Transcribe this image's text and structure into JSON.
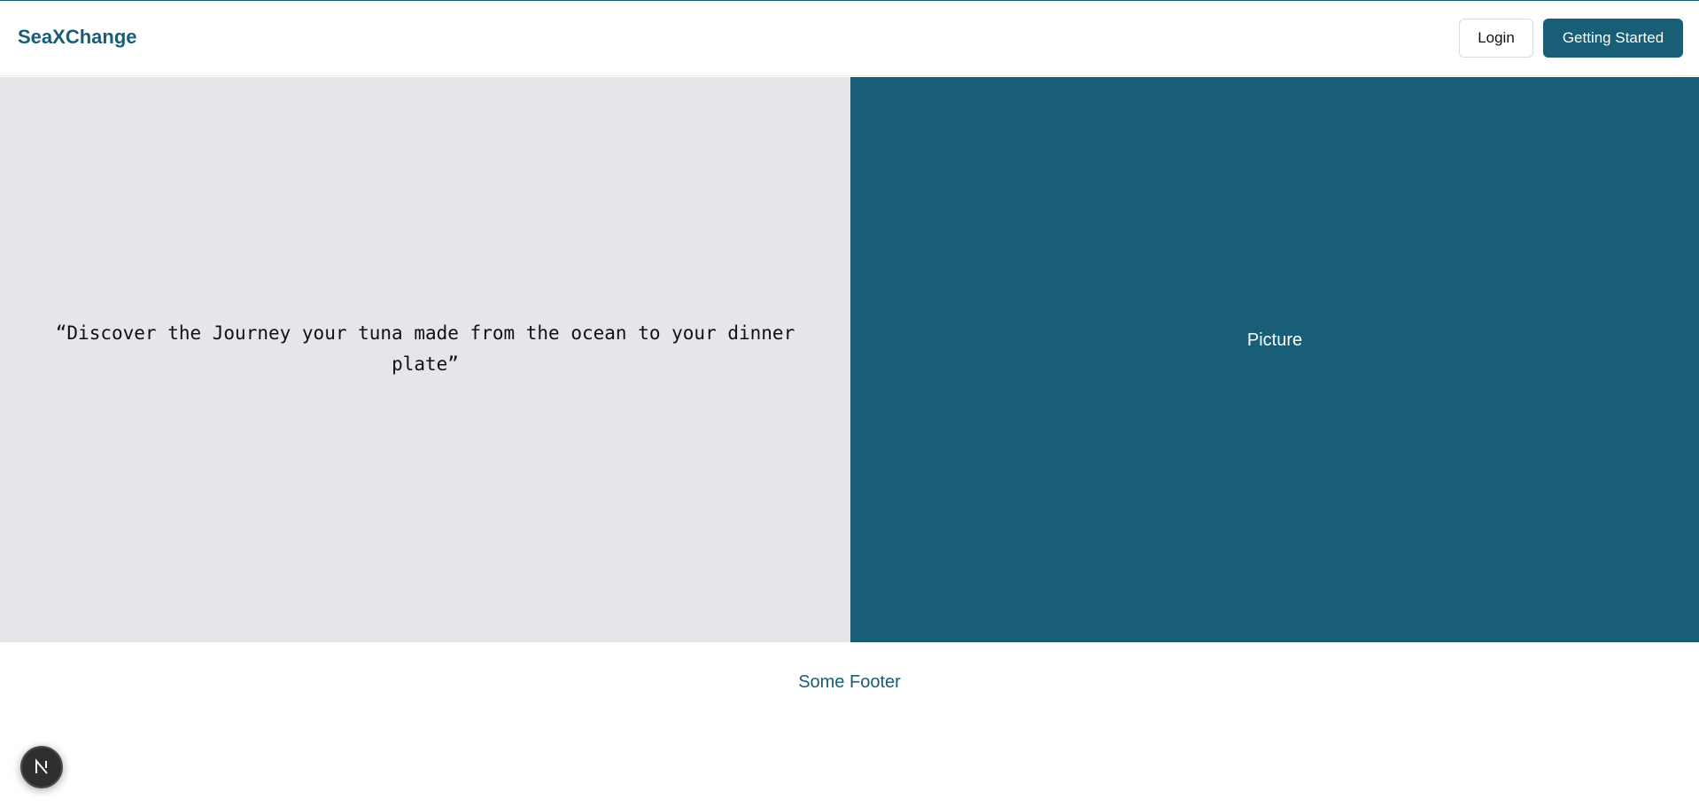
{
  "header": {
    "brand": "SeaXChange",
    "login_label": "Login",
    "start_label": "Getting Started"
  },
  "hero": {
    "quote": "“Discover the Journey your tuna made from the ocean to your dinner plate”",
    "picture_label": "Picture"
  },
  "footer": {
    "text": "Some Footer"
  },
  "dev_badge": {
    "icon": "next-n-icon"
  },
  "colors": {
    "brand": "#175e76",
    "hero_left_bg": "#e5e6ea",
    "badge_bg": "#2f2f2f"
  }
}
